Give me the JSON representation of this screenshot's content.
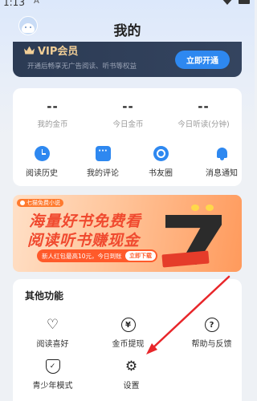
{
  "status_bar": {
    "time": "1:13",
    "extra": "A"
  },
  "header": {
    "title": "我的"
  },
  "vip": {
    "title": "VIP会员",
    "description": "开通后畅享无广告阅读、听书等权益",
    "button": "立即开通"
  },
  "stats": [
    {
      "value": "--",
      "label": "我的金币"
    },
    {
      "value": "--",
      "label": "今日金币"
    },
    {
      "value": "--",
      "label": "今日听读(分钟)"
    }
  ],
  "shortcuts": [
    {
      "label": "阅读历史",
      "icon": "history-clock-icon"
    },
    {
      "label": "我的评论",
      "icon": "comment-icon"
    },
    {
      "label": "书友圈",
      "icon": "friends-circle-icon"
    },
    {
      "label": "消息通知",
      "icon": "bell-icon"
    }
  ],
  "promo": {
    "logo": "七猫免费小说",
    "line1": "海量好书免费看",
    "line2": "阅读听书赚现金",
    "pill": "新人红包最高10元，今日到账",
    "pill_button": "立即下载"
  },
  "other": {
    "title": "其他功能",
    "items": [
      {
        "label": "阅读喜好",
        "icon": "heart-icon",
        "glyph": "♡"
      },
      {
        "label": "金币提现",
        "icon": "yen-icon",
        "glyph": "¥"
      },
      {
        "label": "帮助与反馈",
        "icon": "help-icon",
        "glyph": "?"
      },
      {
        "label": "青少年模式",
        "icon": "shield-icon",
        "glyph": "✓"
      },
      {
        "label": "设置",
        "icon": "gear-icon",
        "glyph": "⚙"
      }
    ]
  },
  "colors": {
    "accent": "#2e88f0",
    "vip_gold": "#f2cf97",
    "annotation_arrow": "#e8262a"
  }
}
